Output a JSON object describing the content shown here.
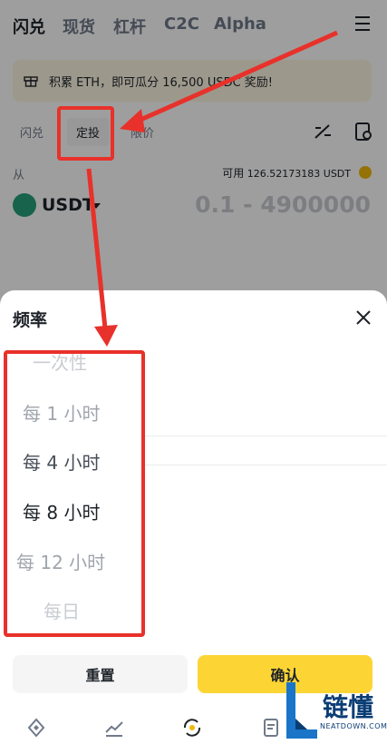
{
  "topnav": {
    "tabs": [
      "闪兑",
      "现货",
      "杠杆",
      "C2C",
      "Alpha"
    ],
    "active_tab": "闪兑"
  },
  "banner": {
    "text": "积累 ETH，即可瓜分 16,500 USDC 奖励!"
  },
  "subtabs": {
    "items": [
      "闪兑",
      "定投",
      "限价"
    ],
    "active": "定投"
  },
  "from": {
    "label": "从",
    "avail_label": "可用",
    "avail_value": "126.52173183 USDT"
  },
  "coin": {
    "name": "USDT",
    "range": "0.1 - 4900000"
  },
  "sheet": {
    "title": "频率",
    "options": [
      "一次性",
      "每 1 小时",
      "每 4 小时",
      "每 8 小时",
      "每 12 小时",
      "每日"
    ],
    "selected": "每 8 小时",
    "reset_label": "重置",
    "confirm_label": "确认"
  },
  "bottom_nav": {
    "icons": [
      "home-icon",
      "markets-icon",
      "trade-icon",
      "orders-icon"
    ]
  },
  "watermark": {
    "text": "链懂",
    "subtext": "NEATDOWN.COM"
  },
  "colors": {
    "accent": "#fcd535",
    "annotation": "#e8312a",
    "coin": "#26a17b"
  }
}
